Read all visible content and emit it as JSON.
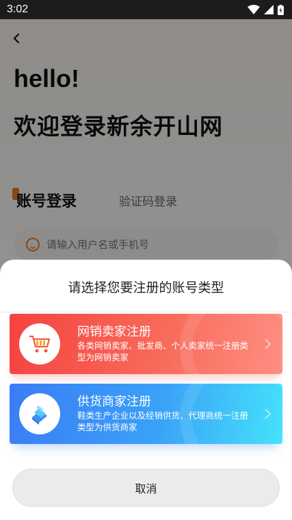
{
  "status_bar": {
    "time": "3:02"
  },
  "login": {
    "greeting": "hello!",
    "welcome": "欢迎登录新余开山网",
    "tabs": [
      {
        "label": "账号登录"
      },
      {
        "label": "验证码登录"
      }
    ],
    "username_placeholder": "请输入用户名或手机号"
  },
  "sheet": {
    "title": "请选择您要注册的账号类型",
    "options": [
      {
        "title": "网销卖家注册",
        "description": "各类网销卖家、批发商、个人卖家统一注册类型为网销卖家",
        "icon": "shopping-cart-icon",
        "color": "#f5433f"
      },
      {
        "title": "供货商家注册",
        "description": "鞋类生产企业以及经销供货、代理商统一注册类型为供货商家",
        "icon": "stack-icon",
        "color": "#3b7cf5"
      }
    ],
    "cancel_label": "取消"
  }
}
